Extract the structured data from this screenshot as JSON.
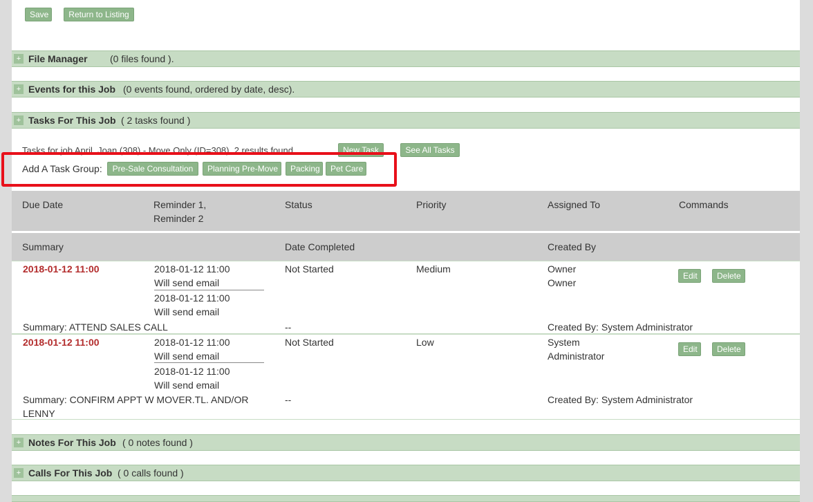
{
  "toolbar": {
    "save_label": "Save",
    "return_label": "Return to Listing"
  },
  "sections": {
    "file_manager": {
      "title": "File Manager",
      "count": "(0 files found )."
    },
    "events": {
      "title": "Events for this Job",
      "count": "(0 events found, ordered by date, desc)."
    },
    "tasks": {
      "title": "Tasks For This Job",
      "count": "( 2 tasks found )"
    },
    "notes": {
      "title": "Notes For This Job",
      "count": "( 0 notes found )"
    },
    "calls": {
      "title": "Calls For This Job",
      "count": "( 0 calls found )"
    }
  },
  "tasks": {
    "info_text": "Tasks for job April, Joan (308) - Move Only (ID=308), 2 results found",
    "new_task_label": "New Task",
    "see_all_label": "See All Tasks",
    "task_group_label": "Add A Task Group:",
    "task_groups": [
      "Pre-Sale Consultation",
      "Planning Pre-Move",
      "Packing",
      "Pet Care"
    ]
  },
  "table": {
    "headers": {
      "due_date": "Due Date",
      "reminder_1": "Reminder 1,",
      "reminder_2": "Reminder 2",
      "status": "Status",
      "priority": "Priority",
      "assigned_to": "Assigned To",
      "commands": "Commands",
      "summary": "Summary",
      "date_completed": "Date Completed",
      "created_by": "Created By"
    },
    "rows": [
      {
        "due": "2018-01-12 11:00",
        "rem1_date": "2018-01-12 11:00",
        "rem1_note": "Will send email",
        "rem2_date": "2018-01-12 11:00",
        "rem2_note": "Will send email",
        "status": "Not Started",
        "priority": "Medium",
        "assigned_line1": "Owner",
        "assigned_line2": "Owner",
        "edit": "Edit",
        "delete": "Delete",
        "summary_line1": "Summary: ATTEND SALES CALL",
        "summary_line2": "",
        "completed": "--",
        "created_by": "Created By: System Administrator"
      },
      {
        "due": "2018-01-12 11:00",
        "rem1_date": "2018-01-12 11:00",
        "rem1_note": "Will send email",
        "rem2_date": "2018-01-12 11:00",
        "rem2_note": "Will send email",
        "status": "Not Started",
        "priority": "Low",
        "assigned_line1": "System",
        "assigned_line2": "Administrator",
        "edit": "Edit",
        "delete": "Delete",
        "summary_line1": "Summary: CONFIRM APPT W MOVER.TL. AND/OR",
        "summary_line2": "LENNY",
        "completed": "--",
        "created_by": "Created By: System Administrator"
      }
    ]
  },
  "colors": {
    "button": "#8db68a",
    "section_bar": "#c7dcc4",
    "due_date": "#b32c2c",
    "highlight": "#e8101a",
    "table_header": "#cdcdcd"
  }
}
